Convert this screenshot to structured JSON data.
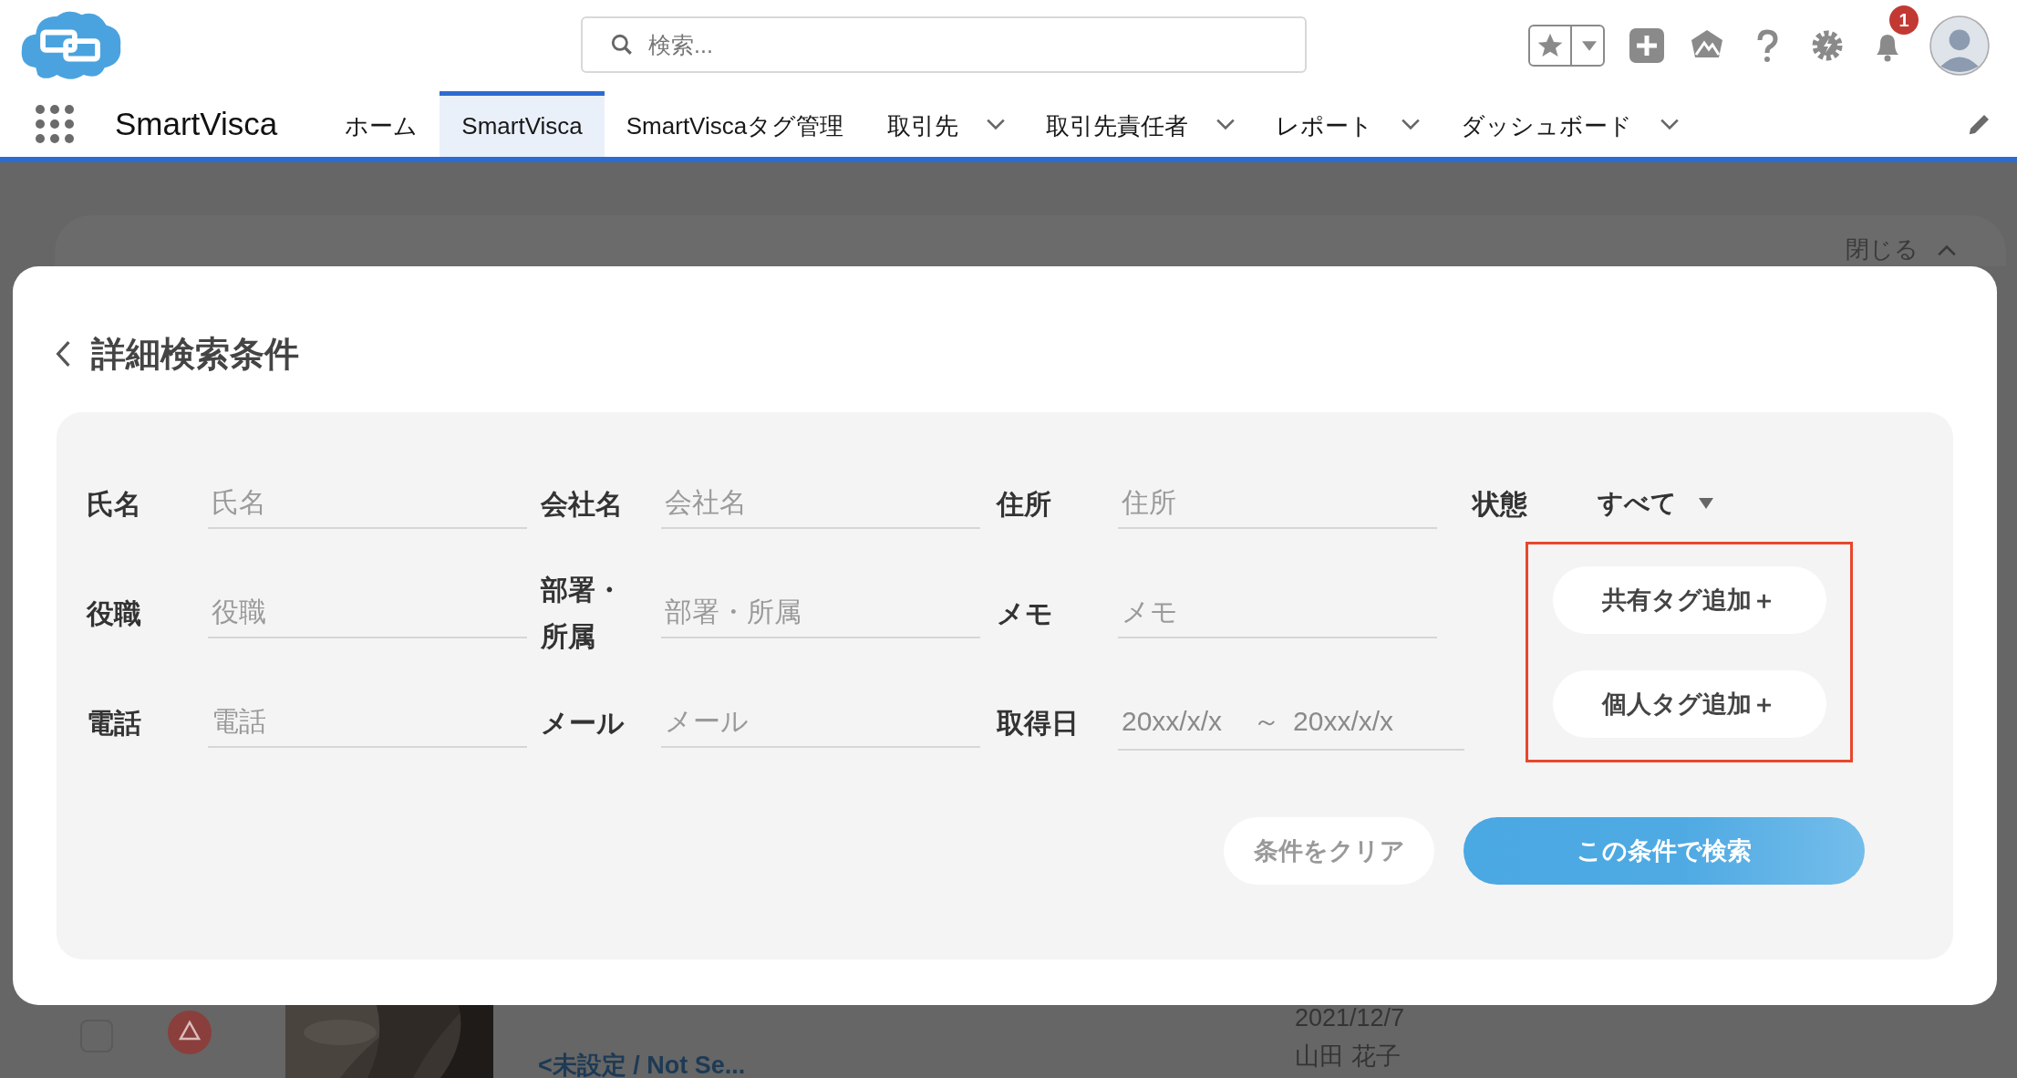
{
  "header": {
    "search": {
      "placeholder": "検索..."
    },
    "notifications": {
      "count": "1"
    }
  },
  "nav": {
    "app_name": "SmartVisca",
    "tabs": [
      {
        "label": "ホーム",
        "selected": false,
        "has_menu": false
      },
      {
        "label": "SmartVisca",
        "selected": true,
        "has_menu": false
      },
      {
        "label": "SmartViscaタグ管理",
        "selected": false,
        "has_menu": false
      },
      {
        "label": "取引先",
        "selected": false,
        "has_menu": true
      },
      {
        "label": "取引先責任者",
        "selected": false,
        "has_menu": true
      },
      {
        "label": "レポート",
        "selected": false,
        "has_menu": true
      },
      {
        "label": "ダッシュボード",
        "selected": false,
        "has_menu": true
      }
    ]
  },
  "background": {
    "close_label": "閉じる",
    "row": {
      "checked": false,
      "date": "2021/12/7",
      "title": "<未設定 / Not Se...",
      "owner": "山田 花子"
    }
  },
  "modal": {
    "title": "詳細検索条件",
    "field_rows": [
      [
        {
          "label": "氏名",
          "kind": "text",
          "placeholder": "氏名"
        },
        {
          "label": "会社名",
          "kind": "text",
          "placeholder": "会社名"
        },
        {
          "label": "住所",
          "kind": "text",
          "placeholder": "住所"
        }
      ],
      [
        {
          "label": "役職",
          "kind": "text",
          "placeholder": "役職"
        },
        {
          "label": "部署・所属",
          "kind": "text",
          "placeholder": "部署・所属"
        },
        {
          "label": "メモ",
          "kind": "text",
          "placeholder": "メモ"
        }
      ],
      [
        {
          "label": "電話",
          "kind": "text",
          "placeholder": "電話"
        },
        {
          "label": "メール",
          "kind": "text",
          "placeholder": "メール"
        },
        {
          "label": "取得日",
          "kind": "date",
          "from": "20xx/x/x",
          "separator": "～",
          "to": "20xx/x/x"
        }
      ]
    ],
    "status": {
      "label": "状態",
      "value": "すべて"
    },
    "tag_buttons": [
      "共有タグ追加＋",
      "個人タグ追加＋"
    ],
    "actions": [
      {
        "label": "条件をクリア",
        "kind": "secondary"
      },
      {
        "label": "この条件で検索",
        "kind": "primary"
      }
    ]
  }
}
